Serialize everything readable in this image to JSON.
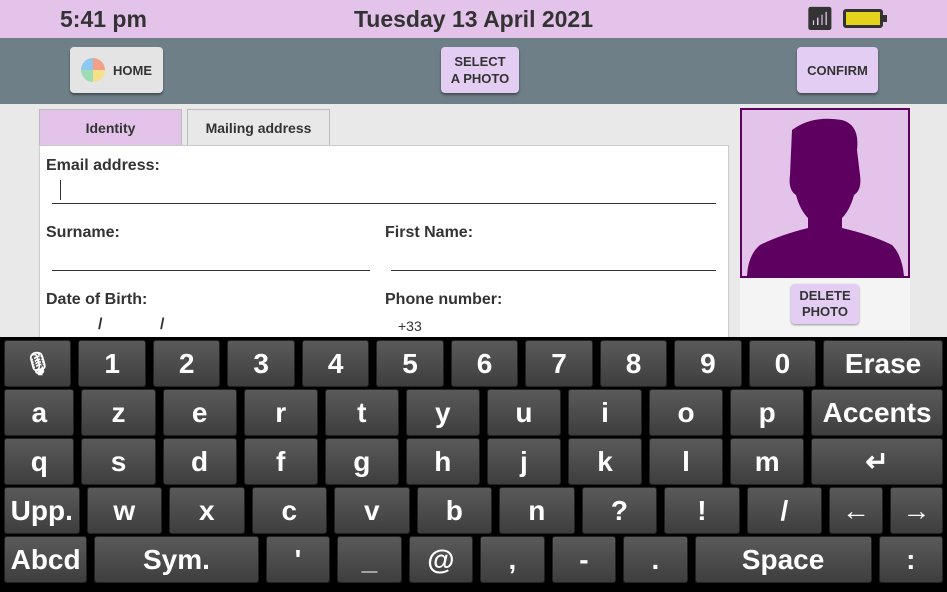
{
  "status": {
    "time": "5:41 pm",
    "date": "Tuesday 13 April 2021",
    "wifi_icon": "wifi-icon",
    "battery_icon": "battery-charging-icon"
  },
  "toolbar": {
    "home": "HOME",
    "select_photo": "SELECT\nA PHOTO",
    "confirm": "CONFIRM"
  },
  "tabs": [
    "Identity",
    "Mailing address"
  ],
  "form": {
    "email_label": "Email address:",
    "email_value": "",
    "surname_label": "Surname:",
    "firstname_label": "First Name:",
    "dob_label": "Date of Birth:",
    "dob_sep": "/",
    "phone_label": "Phone number:",
    "phone_prefix": "+33"
  },
  "photo": {
    "delete": "DELETE\nPHOTO",
    "colors": {
      "bg": "#e3c3ea",
      "silhouette": "#5e0060"
    }
  },
  "keyboard": {
    "rows": [
      [
        "mic",
        "1",
        "2",
        "3",
        "4",
        "5",
        "6",
        "7",
        "8",
        "9",
        "0",
        "Erase"
      ],
      [
        "a",
        "z",
        "e",
        "r",
        "t",
        "y",
        "u",
        "i",
        "o",
        "p",
        "Accents"
      ],
      [
        "q",
        "s",
        "d",
        "f",
        "g",
        "h",
        "j",
        "k",
        "l",
        "m",
        "↵"
      ],
      [
        "Upp.",
        "w",
        "x",
        "c",
        "v",
        "b",
        "n",
        "?",
        "!",
        "/",
        "←",
        "→"
      ],
      [
        "Abcd",
        "Sym.",
        "'",
        "_",
        "@",
        ",",
        "-",
        ".",
        "Space",
        ":"
      ]
    ]
  }
}
